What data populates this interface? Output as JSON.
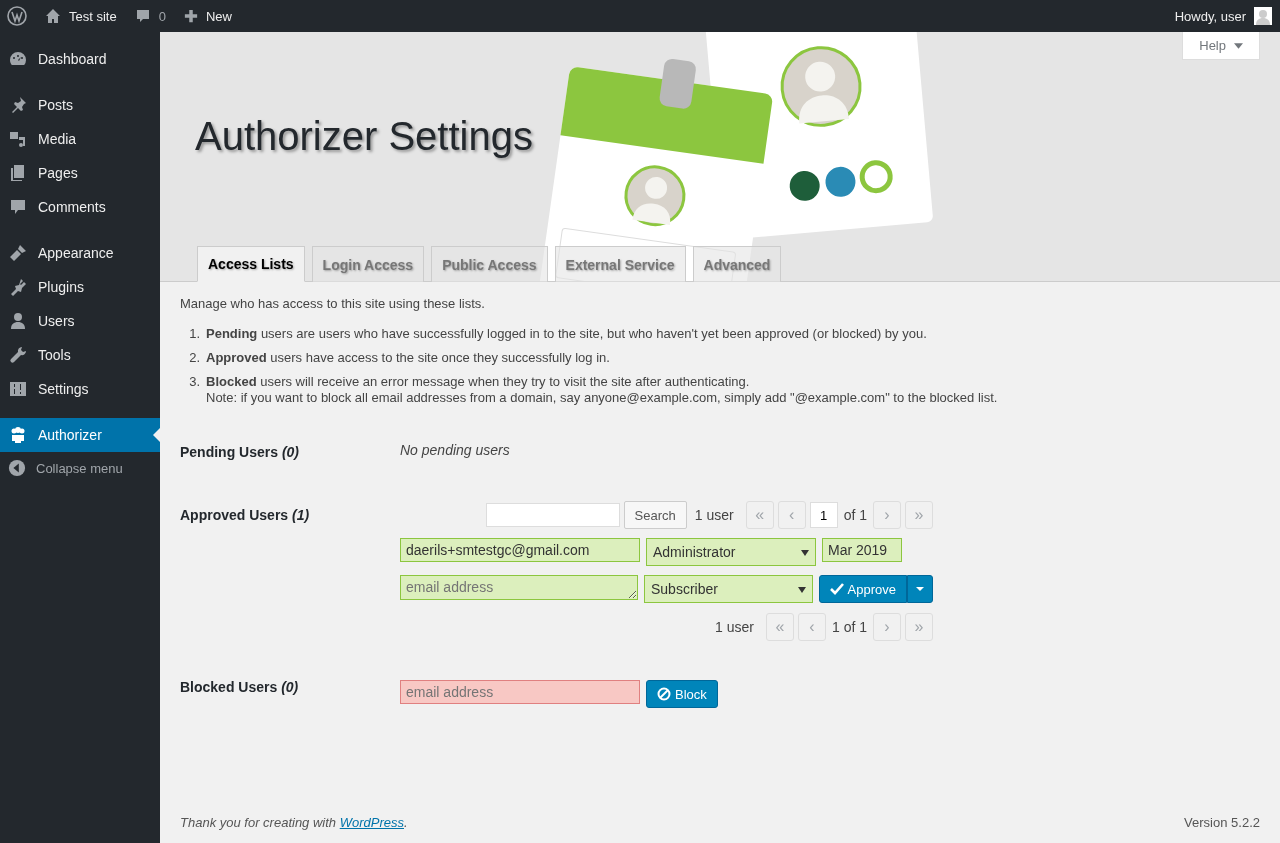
{
  "admin_bar": {
    "site": "Test site",
    "comments": "0",
    "new": "New",
    "greeting": "Howdy, user"
  },
  "sidebar": {
    "groups": [
      {
        "items": [
          {
            "label": "Dashboard",
            "selected": false
          }
        ]
      },
      {
        "items": [
          {
            "label": "Posts",
            "selected": false
          },
          {
            "label": "Media",
            "selected": false
          },
          {
            "label": "Pages",
            "selected": false
          },
          {
            "label": "Comments",
            "selected": false
          }
        ]
      },
      {
        "items": [
          {
            "label": "Appearance",
            "selected": false
          },
          {
            "label": "Plugins",
            "selected": false
          },
          {
            "label": "Users",
            "selected": false
          },
          {
            "label": "Tools",
            "selected": false
          },
          {
            "label": "Settings",
            "selected": false
          }
        ]
      },
      {
        "items": [
          {
            "label": "Authorizer",
            "selected": true
          }
        ]
      }
    ],
    "collapse": "Collapse menu"
  },
  "help": "Help",
  "page_title": "Authorizer Settings",
  "tabs": [
    {
      "label": "Access Lists",
      "selected": true
    },
    {
      "label": "Login Access",
      "selected": false
    },
    {
      "label": "Public Access",
      "selected": false
    },
    {
      "label": "External Service",
      "selected": false
    },
    {
      "label": "Advanced",
      "selected": false
    }
  ],
  "intro": "Manage who has access to this site using these lists.",
  "rules": [
    {
      "number": "1.",
      "text": "**Pending** users are users who have successfully logged in to the site, but who haven't yet been approved (or blocked) by you."
    },
    {
      "number": "2.",
      "text": "**Approved** users have access to the site once they successfully log in."
    },
    {
      "number": "3.",
      "text": "**Blocked** users will receive an error message when they try to visit the site after authenticating.",
      "note": "Note: if you want to block all email addresses from a domain, say anyone@example.com, simply add \"@example.com\" to the blocked list."
    }
  ],
  "pending": {
    "label": "Pending Users *(0)*",
    "empty": "No pending users"
  },
  "approved": {
    "label": "Approved Users *(1)*",
    "search_button": "Search",
    "count": "1 user",
    "pager": {
      "first": {
        "label": "«",
        "disabled": true
      },
      "prev": {
        "label": "‹",
        "disabled": true
      },
      "page": "1",
      "of": "of 1",
      "next": {
        "label": "›",
        "disabled": true
      },
      "last": {
        "label": "»",
        "disabled": true
      }
    },
    "users": [
      {
        "email": "daerils+smtestgc@gmail.com",
        "role": "Administrator",
        "date": "Mar 2019"
      }
    ],
    "new_user": {
      "placeholder": "email address",
      "role": "Subscriber",
      "button": "Approve"
    },
    "bottom_count": "1 user",
    "bottom_pager": {
      "first": {
        "label": "«",
        "disabled": true
      },
      "prev": {
        "label": "‹",
        "disabled": true
      },
      "page_text": "1 of 1",
      "next": {
        "label": "›",
        "disabled": true
      },
      "last": {
        "label": "»",
        "disabled": true
      }
    }
  },
  "blocked": {
    "label": "Blocked Users *(0)*",
    "placeholder": "email address",
    "button": "Block"
  },
  "footer": {
    "before": "Thank you for creating with ",
    "link": "WordPress",
    "after": ".",
    "version": "Version 5.2.2"
  }
}
